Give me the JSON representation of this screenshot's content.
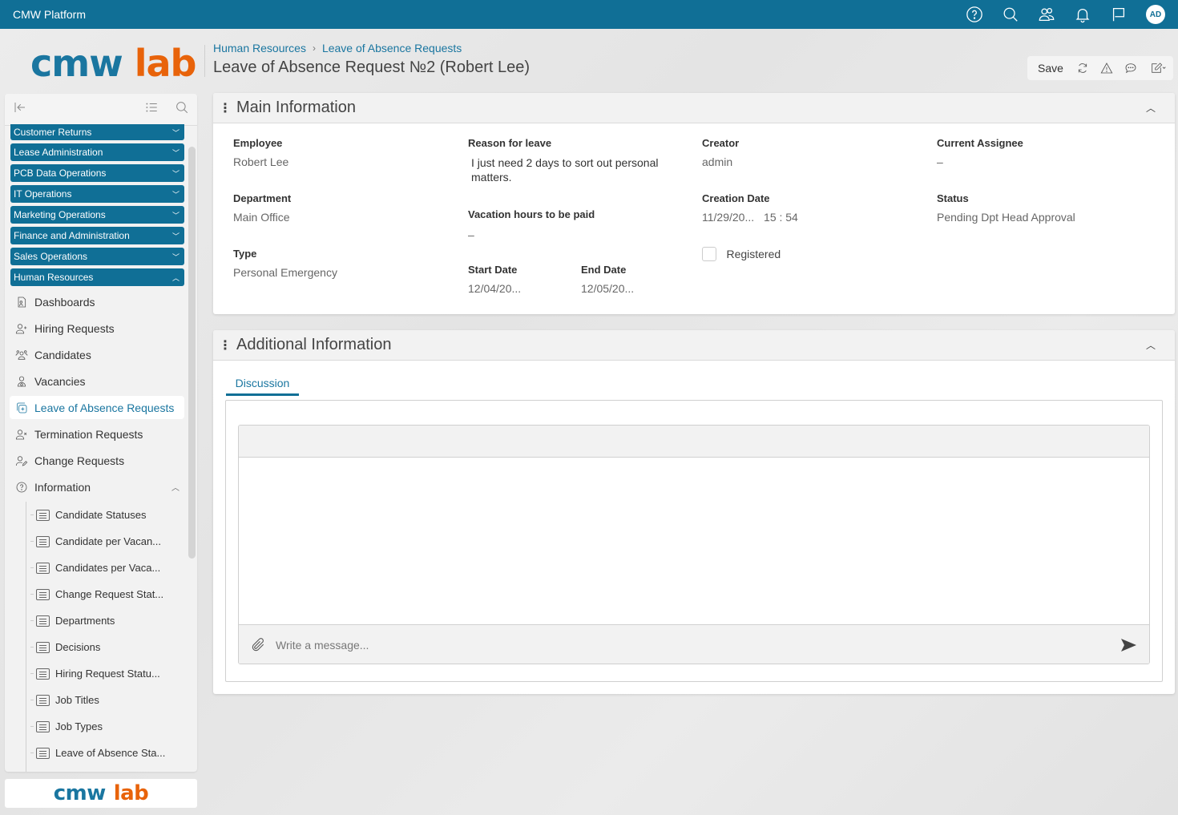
{
  "topbar": {
    "app_title": "CMW Platform",
    "icons": [
      "help-icon",
      "search-icon",
      "users-icon",
      "bell-icon",
      "flag-icon"
    ],
    "avatar_initials": "AD"
  },
  "logo": {
    "part1": "cmw",
    "part2": "lab"
  },
  "breadcrumb": {
    "items": [
      "Human Resources",
      "Leave of Absence Requests"
    ],
    "separator": "›"
  },
  "page_title": "Leave of Absence Request №2 (Robert Lee)",
  "toolbar": {
    "save_label": "Save"
  },
  "sidebar": {
    "groups": [
      {
        "label": "Customer Returns",
        "expanded": false
      },
      {
        "label": "Lease Administration",
        "expanded": false
      },
      {
        "label": "PCB Data Operations",
        "expanded": false
      },
      {
        "label": "IT Operations",
        "expanded": false
      },
      {
        "label": "Marketing Operations",
        "expanded": false
      },
      {
        "label": "Finance and Administration",
        "expanded": false
      },
      {
        "label": "Sales Operations",
        "expanded": false
      },
      {
        "label": "Human Resources",
        "expanded": true
      }
    ],
    "items": [
      {
        "label": "Dashboards",
        "icon": "dashboard-icon"
      },
      {
        "label": "Hiring Requests",
        "icon": "user-plus-icon"
      },
      {
        "label": "Candidates",
        "icon": "users-group-icon"
      },
      {
        "label": "Vacancies",
        "icon": "vacancy-icon"
      },
      {
        "label": "Leave of Absence Requests",
        "icon": "leave-icon",
        "active": true
      },
      {
        "label": "Termination Requests",
        "icon": "user-x-icon"
      },
      {
        "label": "Change Requests",
        "icon": "user-edit-icon"
      },
      {
        "label": "Information",
        "icon": "help-circle-icon",
        "expanded": true
      }
    ],
    "sub_items": [
      "Candidate Statuses",
      "Candidate per Vacan...",
      "Candidates per Vaca...",
      "Change Request Stat...",
      "Departments",
      "Decisions",
      "Hiring Request Statu...",
      "Job Titles",
      "Job Types",
      "Leave of Absence Sta..."
    ],
    "footer_logo": {
      "part1": "cmw",
      "part2": "lab"
    }
  },
  "main_info": {
    "title": "Main Information",
    "fields": {
      "employee": {
        "label": "Employee",
        "value": "Robert Lee"
      },
      "department": {
        "label": "Department",
        "value": "Main Office"
      },
      "type": {
        "label": "Type",
        "value": "Personal Emergency"
      },
      "reason": {
        "label": "Reason for leave",
        "value": "I just need 2 days to sort out personal matters."
      },
      "vacation_hours": {
        "label": "Vacation hours to be paid",
        "value": "–"
      },
      "start_date": {
        "label": "Start Date",
        "value": "12/04/20..."
      },
      "end_date": {
        "label": "End Date",
        "value": "12/05/20..."
      },
      "creator": {
        "label": "Creator",
        "value": "admin"
      },
      "creation_date": {
        "label": "Creation Date",
        "value": "11/29/20...",
        "time": "15 : 54"
      },
      "registered": {
        "label": "Registered",
        "checked": false
      },
      "current_assignee": {
        "label": "Current Assignee",
        "value": "–"
      },
      "status": {
        "label": "Status",
        "value": "Pending Dpt Head Approval"
      }
    }
  },
  "additional_info": {
    "title": "Additional Information",
    "tabs": [
      {
        "label": "Discussion",
        "active": true
      }
    ],
    "message_placeholder": "Write a message..."
  },
  "colors": {
    "brand_primary": "#106f96",
    "brand_accent": "#e8630a",
    "link": "#1a76a0"
  }
}
